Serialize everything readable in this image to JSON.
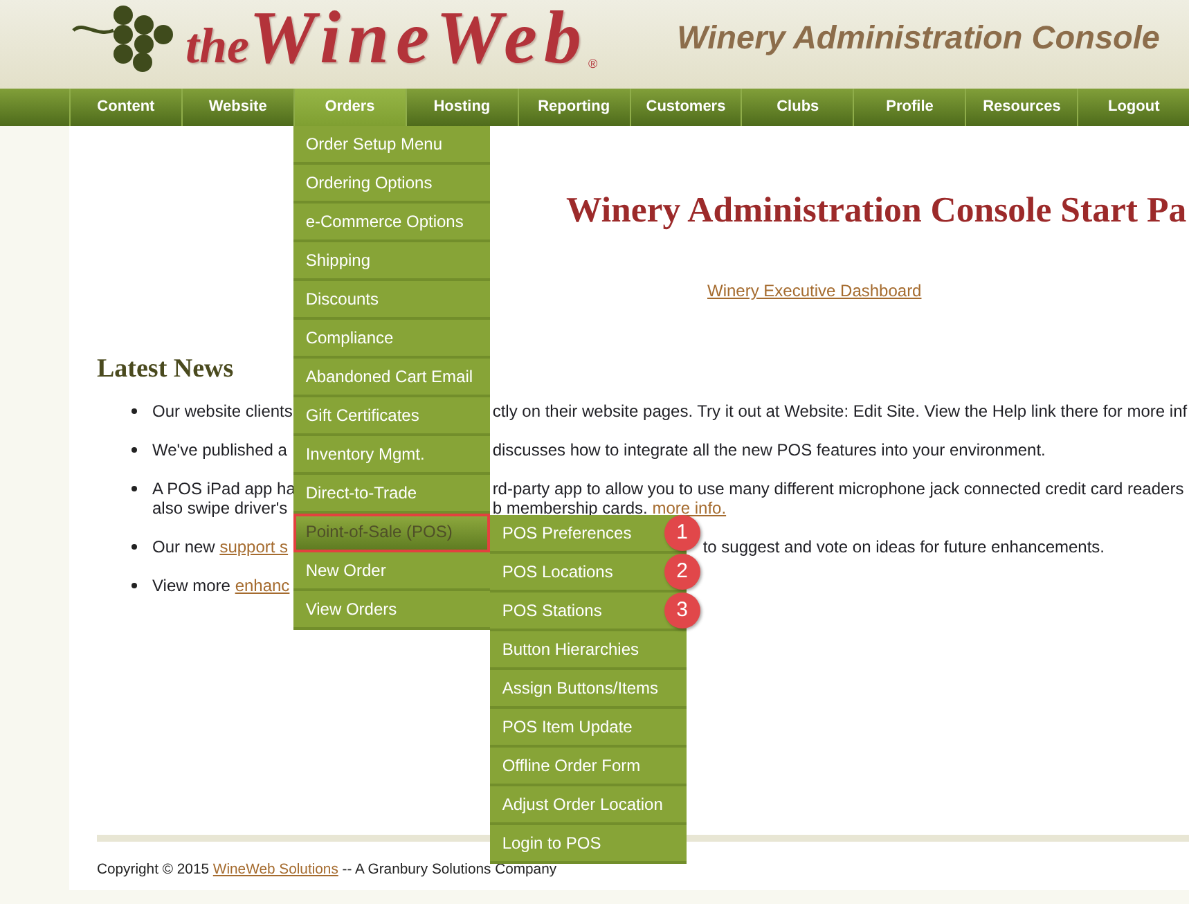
{
  "header": {
    "logo": {
      "small": "the",
      "large": "WineWeb",
      "registered": "®"
    },
    "title": "Winery Administration Console"
  },
  "nav": [
    {
      "label": "Content",
      "selected": false
    },
    {
      "label": "Website",
      "selected": false
    },
    {
      "label": "Orders",
      "selected": true,
      "menu": [
        {
          "label": "Order Setup Menu",
          "selected": false,
          "outlined": false
        },
        {
          "label": "Ordering Options",
          "selected": false,
          "outlined": false
        },
        {
          "label": "e-Commerce Options",
          "selected": false,
          "outlined": false
        },
        {
          "label": "Shipping",
          "selected": false,
          "outlined": false
        },
        {
          "label": "Discounts",
          "selected": false,
          "outlined": false
        },
        {
          "label": "Compliance",
          "selected": false,
          "outlined": false
        },
        {
          "label": "Abandoned Cart Email",
          "selected": false,
          "outlined": false
        },
        {
          "label": "Gift Certificates",
          "selected": false,
          "outlined": false
        },
        {
          "label": "Inventory Mgmt.",
          "selected": false,
          "outlined": false
        },
        {
          "label": "Direct-to-Trade",
          "selected": false,
          "outlined": false
        },
        {
          "label": "Point-of-Sale (POS)",
          "selected": true,
          "outlined": true,
          "children": [
            {
              "label": "POS Preferences",
              "selected": false,
              "callout": "1"
            },
            {
              "label": "POS Locations",
              "selected": false,
              "callout": "2"
            },
            {
              "label": "POS Stations",
              "selected": false,
              "callout": "3"
            },
            {
              "label": "Button Hierarchies",
              "selected": false
            },
            {
              "label": "Assign Buttons/Items",
              "selected": false
            },
            {
              "label": "POS Item Update",
              "selected": false
            },
            {
              "label": "Offline Order Form",
              "selected": false
            },
            {
              "label": "Adjust Order Location",
              "selected": false
            },
            {
              "label": "Login to POS",
              "selected": false
            }
          ]
        },
        {
          "label": "New Order",
          "selected": false,
          "outlined": false
        },
        {
          "label": "View Orders",
          "selected": false,
          "outlined": false
        }
      ]
    },
    {
      "label": "Hosting",
      "selected": false
    },
    {
      "label": "Reporting",
      "selected": false
    },
    {
      "label": "Customers",
      "selected": false
    },
    {
      "label": "Clubs",
      "selected": false
    },
    {
      "label": "Profile",
      "selected": false
    },
    {
      "label": "Resources",
      "selected": false
    },
    {
      "label": "Logout",
      "selected": false
    }
  ],
  "main": {
    "heading": "Winery Administration Console Start Pa",
    "dashboard_link": "Winery Executive Dashboard"
  },
  "latest_news": {
    "title": "Latest News",
    "items": [
      {
        "lines": [
          {
            "start": [
              {
                "kind": "text",
                "text": "Our website clients"
              }
            ],
            "end": [
              {
                "kind": "text",
                "text": "ctly on their website pages. Try it out at Website: Edit Site. View the Help link there for more inf"
              }
            ]
          }
        ]
      },
      {
        "lines": [
          {
            "start": [
              {
                "kind": "text",
                "text": "We've published a"
              }
            ],
            "end": [
              {
                "kind": "text",
                "text": "discusses how to integrate all the new POS features into your environment."
              }
            ]
          }
        ]
      },
      {
        "lines": [
          {
            "start": [
              {
                "kind": "text",
                "text": "A POS iPad app ha"
              }
            ],
            "end": [
              {
                "kind": "text",
                "text": "rd-party app to allow you to use many different microphone jack connected credit card readers"
              }
            ]
          },
          {
            "start": [
              {
                "kind": "text",
                "text": "also swipe driver's"
              }
            ],
            "end": [
              {
                "kind": "text",
                "text": "b membership cards. "
              },
              {
                "kind": "link",
                "text": "more info."
              }
            ]
          }
        ]
      },
      {
        "lines": [
          {
            "start": [
              {
                "kind": "text",
                "text": "Our new "
              },
              {
                "kind": "link",
                "text": "support s"
              }
            ],
            "end": [
              {
                "kind": "text",
                "text": "to suggest and vote on ideas for future enhancements."
              }
            ]
          }
        ]
      },
      {
        "lines": [
          {
            "start": [
              {
                "kind": "text",
                "text": "View more "
              },
              {
                "kind": "link",
                "text": "enhanc"
              }
            ]
          }
        ]
      }
    ]
  },
  "footer": {
    "copyright": [
      {
        "kind": "text",
        "text": "Copyright © 2015 "
      },
      {
        "kind": "link",
        "text": "WineWeb Solutions"
      },
      {
        "kind": "text",
        "text": " -- A Granbury Solutions Company"
      }
    ]
  }
}
